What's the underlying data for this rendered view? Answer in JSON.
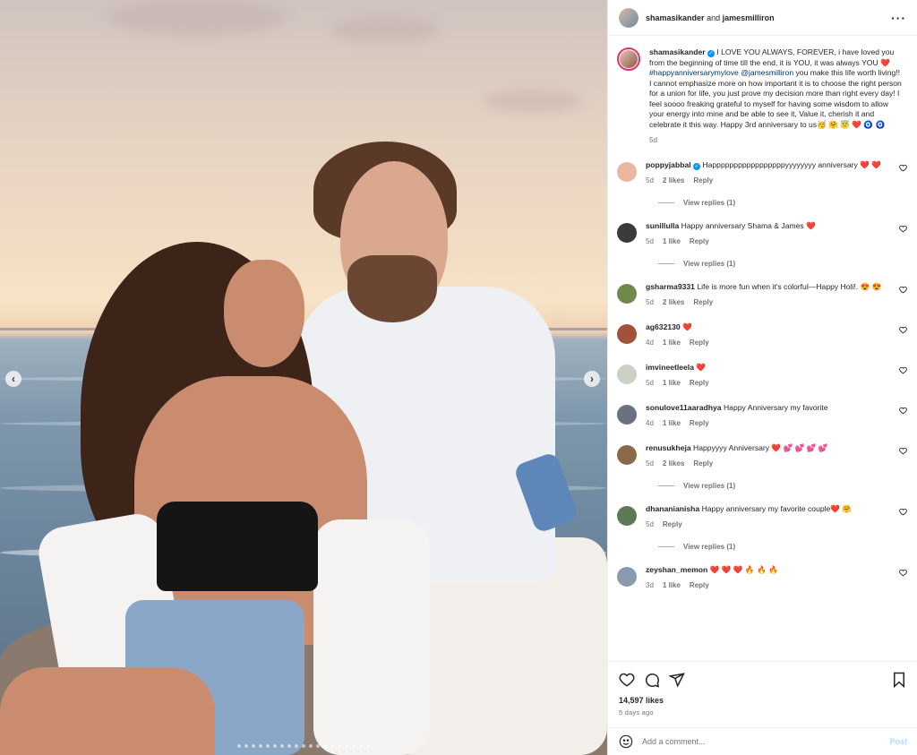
{
  "post": {
    "author": "shamasikander",
    "coauthor": "jamesmilliron",
    "and_text": "and",
    "more_icon": "more-horizontal-icon",
    "image_count": 19,
    "active_index": 12
  },
  "caption": {
    "user": "shamasikander",
    "text_1": "I LOVE YOU ALWAYS, FOREVER, i have loved you from the beginning of time till the end, it is YOU, it was always YOU ❤️",
    "hashtag": "#happyanniversarymylove",
    "mention": "@jamesmilliron",
    "text_2": "you make this life worth living!! I cannot emphasize more on how important it is to choose the right person for a union for life, you just prove my decision more than right every day! I feel soooo freaking grateful to myself for having some wisdom to allow your energy into mine and be able to see it, Value it, cherish it and celebrate it this way. Happy 3rd anniversary to us🥳 🤗 😇 ❤️ 🧿 🧿",
    "time": "5d"
  },
  "comments": [
    {
      "user": "poppyjabbal",
      "verified": true,
      "text": "Happpppppppppppppppyyyyyyyy anniversary ❤️ ❤️",
      "time": "5d",
      "likes": "2 likes",
      "reply": "Reply",
      "view_replies": "View replies (1)",
      "avatar_color": "#e9b7a0"
    },
    {
      "user": "sunillulla",
      "verified": false,
      "text": "Happy anniversary Shama & James ❤️",
      "time": "5d",
      "likes": "1 like",
      "reply": "Reply",
      "view_replies": "View replies (1)",
      "avatar_color": "#3b3b3b"
    },
    {
      "user": "gsharma9331",
      "verified": false,
      "text": "Life is more fun when it's colorful—Happy Holi!. 😍 😍",
      "time": "5d",
      "likes": "2 likes",
      "reply": "Reply",
      "view_replies": "",
      "avatar_color": "#6f8a4c"
    },
    {
      "user": "ag632130",
      "verified": false,
      "text": "❤️",
      "time": "4d",
      "likes": "1 like",
      "reply": "Reply",
      "view_replies": "",
      "avatar_color": "#a0523a"
    },
    {
      "user": "imvineetleela",
      "verified": false,
      "text": "❤️",
      "time": "5d",
      "likes": "1 like",
      "reply": "Reply",
      "view_replies": "",
      "avatar_color": "#c9d2c4"
    },
    {
      "user": "sonulove11aaradhya",
      "verified": false,
      "text": "Happy Anniversary my favorite",
      "time": "4d",
      "likes": "1 like",
      "reply": "Reply",
      "view_replies": "",
      "avatar_color": "#6a7280"
    },
    {
      "user": "renusukheja",
      "verified": false,
      "text": "Happyyyy Anniversary ❤️ 💕 💕 💕 💕",
      "time": "5d",
      "likes": "2 likes",
      "reply": "Reply",
      "view_replies": "View replies (1)",
      "avatar_color": "#8a6a4a"
    },
    {
      "user": "dhananianisha",
      "verified": false,
      "text": "Happy anniversary my favorite couple❤️ 🤗",
      "time": "5d",
      "likes": "",
      "reply": "Reply",
      "view_replies": "View replies (1)",
      "avatar_color": "#5e7a54"
    },
    {
      "user": "zeyshan_memon",
      "verified": false,
      "text": "❤️ ❤️ ❤️ 🔥 🔥 🔥",
      "time": "3d",
      "likes": "1 like",
      "reply": "Reply",
      "view_replies": "",
      "avatar_color": "#8a9bb0"
    }
  ],
  "actions": {
    "like_icon": "heart-icon",
    "comment_icon": "comment-icon",
    "share_icon": "share-icon",
    "save_icon": "bookmark-icon",
    "likes": "14,597 likes",
    "time_ago": "5 days ago"
  },
  "add_comment": {
    "placeholder": "Add a comment...",
    "post_label": "Post",
    "emoji_icon": "emoji-icon"
  },
  "colors": {
    "link": "#00376b",
    "muted": "#737373",
    "post_disabled": "#b3dbff",
    "verified": "#0095f6"
  }
}
